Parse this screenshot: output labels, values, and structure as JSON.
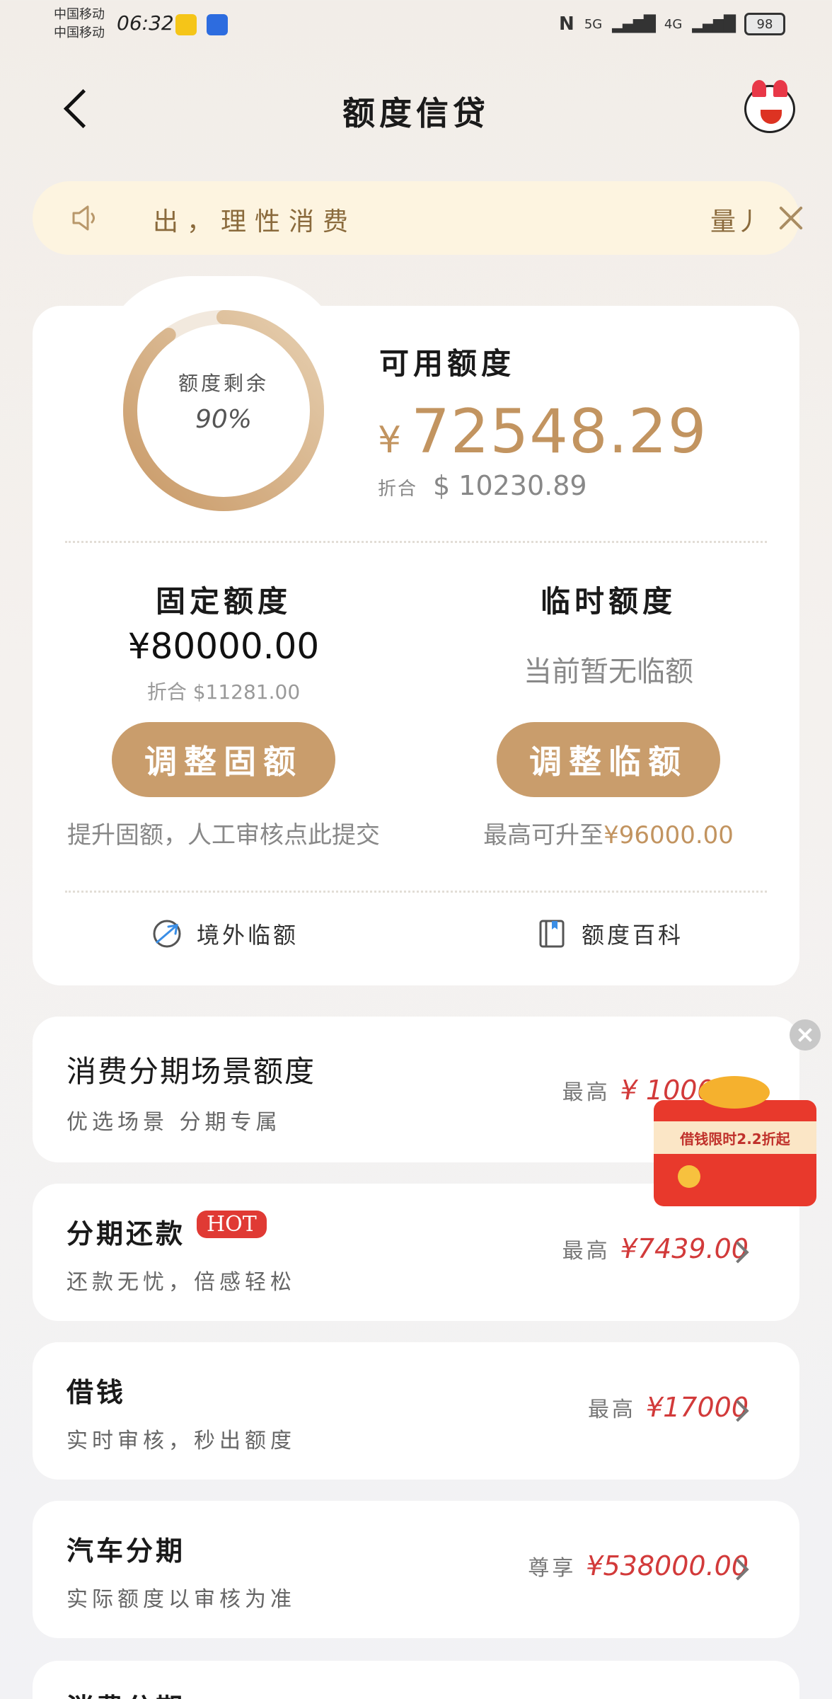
{
  "status_bar": {
    "carrier_1": "中国移动",
    "carrier_2": "中国移动",
    "time": "06:32",
    "network_1": "5G",
    "network_2": "4G",
    "battery": "98"
  },
  "header": {
    "title": "额度信贷"
  },
  "notice": {
    "text": "出，理性消费",
    "tail": "量丿"
  },
  "credit": {
    "ring_label": "额度剩余",
    "ring_percent_text": "90%",
    "remaining_fraction": 0.9,
    "available_label": "可用额度",
    "currency_symbol": "¥",
    "available_amount": "72548.29",
    "converted_label": "折合",
    "converted_amount": "$ 10230.89",
    "fixed": {
      "title": "固定额度",
      "amount": "¥80000.00",
      "converted": "折合 $11281.00",
      "button": "调整固额",
      "hint": "提升固额，人工审核点此提交"
    },
    "temporary": {
      "title": "临时额度",
      "status": "当前暂无临额",
      "button": "调整临额",
      "hint_prefix": "最高可升至",
      "hint_amount": "¥96000.00"
    },
    "links": {
      "overseas": "境外临额",
      "encyclopedia": "额度百科"
    }
  },
  "products": [
    {
      "title": "消费分期场景额度",
      "subtitle": "优选场景 分期专属",
      "prefix": "最高",
      "value": "¥ 100000"
    },
    {
      "title": "分期还款",
      "badge": "HOT",
      "subtitle": "还款无忧，倍感轻松",
      "prefix": "最高",
      "value": "¥7439.00"
    },
    {
      "title": "借钱",
      "subtitle": "实时审核，秒出额度",
      "prefix": "最高",
      "value": "¥17000"
    },
    {
      "title": "汽车分期",
      "subtitle": "实际额度以审核为准",
      "prefix": "尊享",
      "value": "¥538000.00"
    },
    {
      "title": "消费分期"
    }
  ],
  "promo": {
    "text": "借钱限时2.2折起"
  },
  "colors": {
    "accent_gold": "#c99d6c",
    "amount_gold": "#c29460",
    "highlight_red": "#d23a3a",
    "notice_bg": "#fdf4e0"
  }
}
